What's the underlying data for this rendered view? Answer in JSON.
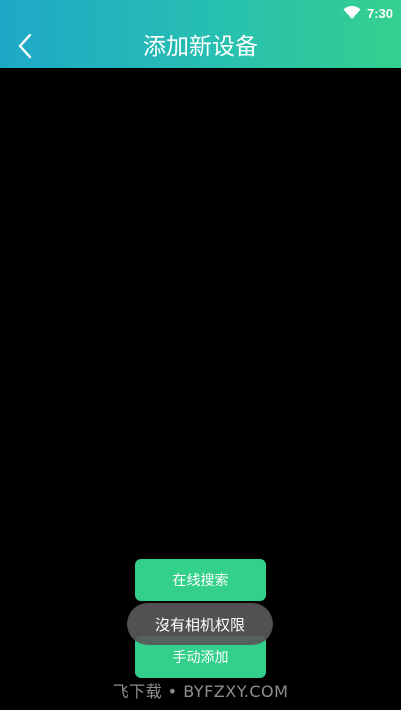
{
  "status_bar": {
    "time": "7:30",
    "wifi_icon": "wifi-icon"
  },
  "header": {
    "title": "添加新设备",
    "back_icon": "chevron-left-icon"
  },
  "buttons": {
    "search_label": "在线搜索",
    "manual_label": "手动添加"
  },
  "toast": {
    "message": "沒有相机权限"
  },
  "watermark": {
    "text": "飞下载 • BYFZXY.COM"
  },
  "colors": {
    "header_gradient_start": "#1ea8c8",
    "header_gradient_end": "#34d08e",
    "button_green": "#32d08a",
    "background": "#000000"
  }
}
